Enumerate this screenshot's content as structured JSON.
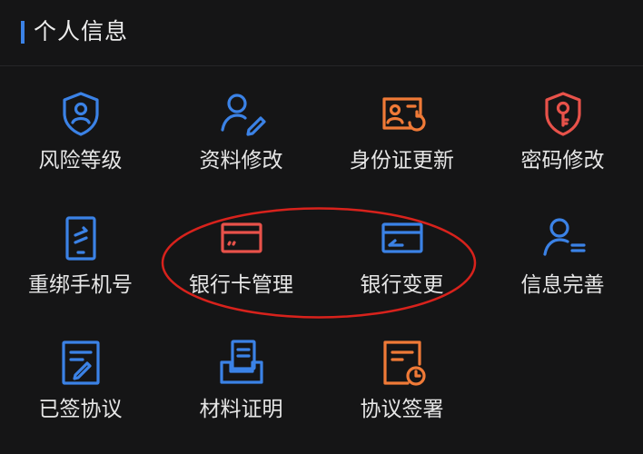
{
  "section": {
    "title": "个人信息"
  },
  "colors": {
    "background": "#151516",
    "blue": "#3b82e6",
    "orange": "#f07a37",
    "red": "#e8524a",
    "annotation_circle": "#d8221c"
  },
  "tiles": [
    {
      "label": "风险等级",
      "icon": "shield-person-icon"
    },
    {
      "label": "资料修改",
      "icon": "user-edit-icon"
    },
    {
      "label": "身份证更新",
      "icon": "id-card-refresh-icon"
    },
    {
      "label": "密码修改",
      "icon": "shield-key-icon"
    },
    {
      "label": "重绑手机号",
      "icon": "phone-refresh-icon"
    },
    {
      "label": "银行卡管理",
      "icon": "bank-card-icon"
    },
    {
      "label": "银行变更",
      "icon": "bank-card-change-icon"
    },
    {
      "label": "信息完善",
      "icon": "user-list-icon"
    },
    {
      "label": "已签协议",
      "icon": "signed-document-icon"
    },
    {
      "label": "材料证明",
      "icon": "document-tray-icon"
    },
    {
      "label": "协议签署",
      "icon": "document-clock-icon"
    }
  ]
}
